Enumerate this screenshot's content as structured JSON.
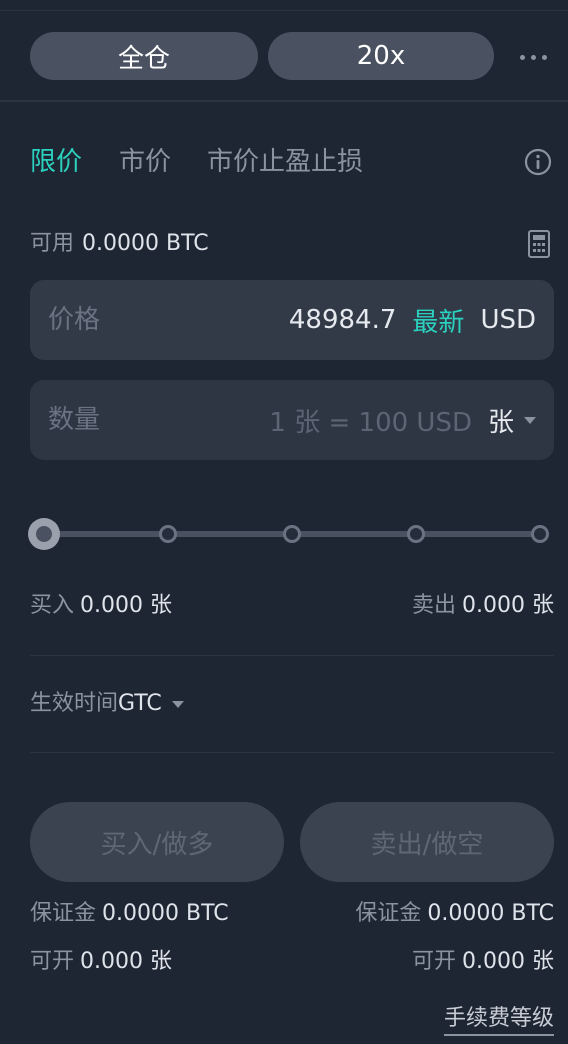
{
  "header": {
    "margin_mode": "全仓",
    "leverage": "20x"
  },
  "order_tabs": [
    "限价",
    "市价",
    "市价止盈止损"
  ],
  "active_tab_index": 0,
  "available": {
    "label": "可用",
    "value": "0.0000 BTC"
  },
  "price_field": {
    "label": "价格",
    "value": "48984.7",
    "latest_label": "最新",
    "unit": "USD"
  },
  "quantity_field": {
    "placeholder": "数量",
    "hint": "1 张 = 100 USD",
    "unit": "张"
  },
  "slider": {
    "value_percent": 0,
    "stops_percent": [
      0,
      25,
      50,
      75,
      100
    ]
  },
  "buy_qty": {
    "label": "买入",
    "value": "0.000 张"
  },
  "sell_qty": {
    "label": "卖出",
    "value": "0.000 张"
  },
  "time_in_force": {
    "label": "生效时间",
    "value": "GTC"
  },
  "buttons": {
    "buy": "买入/做多",
    "sell": "卖出/做空"
  },
  "buy_margin": {
    "label": "保证金",
    "value": "0.0000 BTC"
  },
  "sell_margin": {
    "label": "保证金",
    "value": "0.0000 BTC"
  },
  "buy_openable": {
    "label": "可开",
    "value": "0.000 张"
  },
  "sell_openable": {
    "label": "可开",
    "value": "0.000 张"
  },
  "fee_level_link": "手续费等级",
  "colors": {
    "background": "#1f2633",
    "accent": "#2bd1bf",
    "pill": "#4a5262",
    "field": "#323a48",
    "muted_text": "#8b93a1"
  },
  "icons": [
    "more-icon",
    "info-icon",
    "calculator-icon",
    "dropdown-caret-icon"
  ]
}
